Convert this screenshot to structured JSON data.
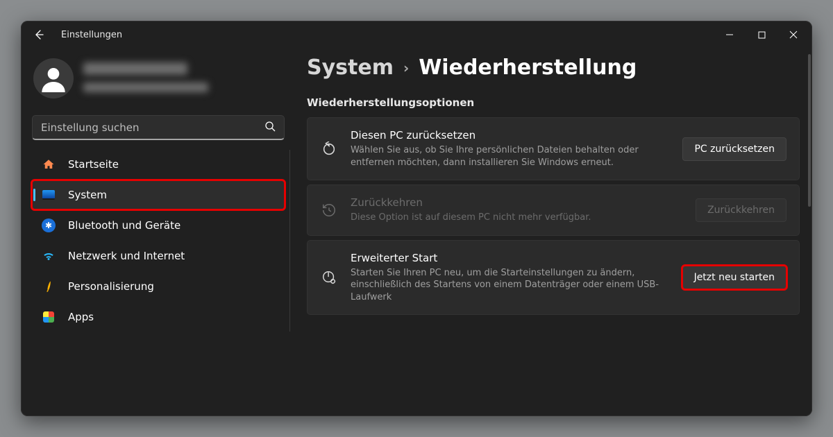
{
  "titlebar": {
    "app_title": "Einstellungen"
  },
  "search": {
    "placeholder": "Einstellung suchen"
  },
  "sidebar": {
    "items": [
      {
        "label": "Startseite"
      },
      {
        "label": "System"
      },
      {
        "label": "Bluetooth und Geräte"
      },
      {
        "label": "Netzwerk und Internet"
      },
      {
        "label": "Personalisierung"
      },
      {
        "label": "Apps"
      }
    ]
  },
  "breadcrumb": {
    "parent": "System",
    "current": "Wiederherstellung"
  },
  "section_title": "Wiederherstellungsoptionen",
  "cards": {
    "reset": {
      "title": "Diesen PC zurücksetzen",
      "desc": "Wählen Sie aus, ob Sie Ihre persönlichen Dateien behalten oder entfernen möchten, dann installieren Sie Windows erneut.",
      "button": "PC zurücksetzen"
    },
    "goback": {
      "title": "Zurückkehren",
      "desc": "Diese Option ist auf diesem PC nicht mehr verfügbar.",
      "button": "Zurückkehren"
    },
    "advanced": {
      "title": "Erweiterter Start",
      "desc": "Starten Sie Ihren PC neu, um die Starteinstellungen zu ändern, einschließlich des Startens von einem Datenträger oder einem USB-Laufwerk",
      "button": "Jetzt neu starten"
    }
  }
}
